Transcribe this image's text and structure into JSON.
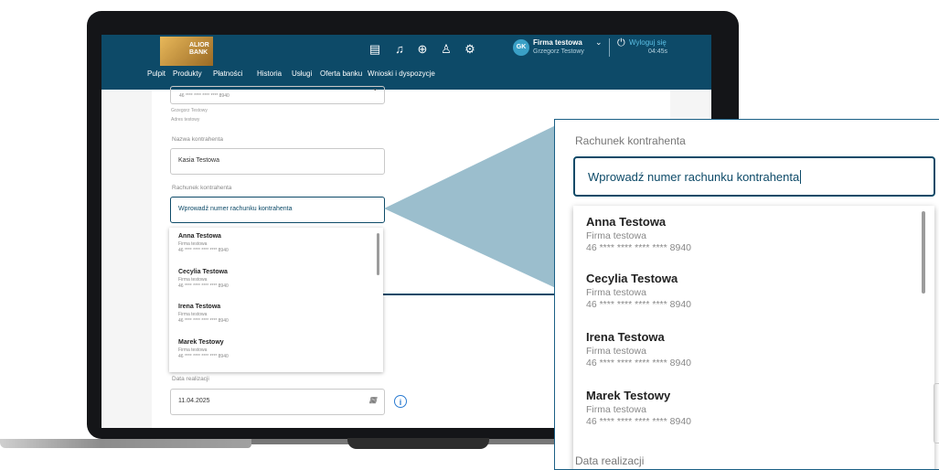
{
  "header": {
    "bank_name_line1": "ALIOR",
    "bank_name_line2": "BANK",
    "avatar_initials": "GK",
    "company": "Firma testowa",
    "user": "Grzegorz Testowy",
    "logout_label": "Wyloguj się",
    "session_timer": "04:45s"
  },
  "nav": [
    "Pulpit",
    "Produkty",
    "Płatności",
    "Historia",
    "Usługi",
    "Oferta banku",
    "Wnioski i dyspozycje"
  ],
  "form": {
    "source_account": "46 **** **** **** **** 8940",
    "sender_name": "Grzegorz Testowy",
    "sender_address": "Adres testowy",
    "payee_name_label": "Nazwa kontrahenta",
    "payee_name_value": "Kasia Testowa",
    "payee_account_label": "Rachunek kontrahenta",
    "payee_account_placeholder": "Wprowadź numer rachunku kontrahenta",
    "date_label": "Data realizacji",
    "date_value": "11.04.2025"
  },
  "suggestions": [
    {
      "name": "Anna Testowa",
      "company": "Firma testowa",
      "account": "46 **** **** **** **** 8940"
    },
    {
      "name": "Cecylia Testowa",
      "company": "Firma testowa",
      "account": "46 **** **** **** **** 8940"
    },
    {
      "name": "Irena Testowa",
      "company": "Firma testowa",
      "account": "46 **** **** **** **** 8940"
    },
    {
      "name": "Marek Testowy",
      "company": "Firma testowa",
      "account": "46 **** **** **** **** 8940"
    }
  ],
  "colors": {
    "brand": "#0d4a68",
    "link": "#5cc0e6",
    "accent": "#2a7bd1"
  },
  "icons": [
    "document-icon",
    "bell-icon",
    "download-icon",
    "user-icon",
    "gear-icon",
    "chevron-down-icon",
    "power-icon",
    "calendar-icon",
    "info-icon"
  ]
}
